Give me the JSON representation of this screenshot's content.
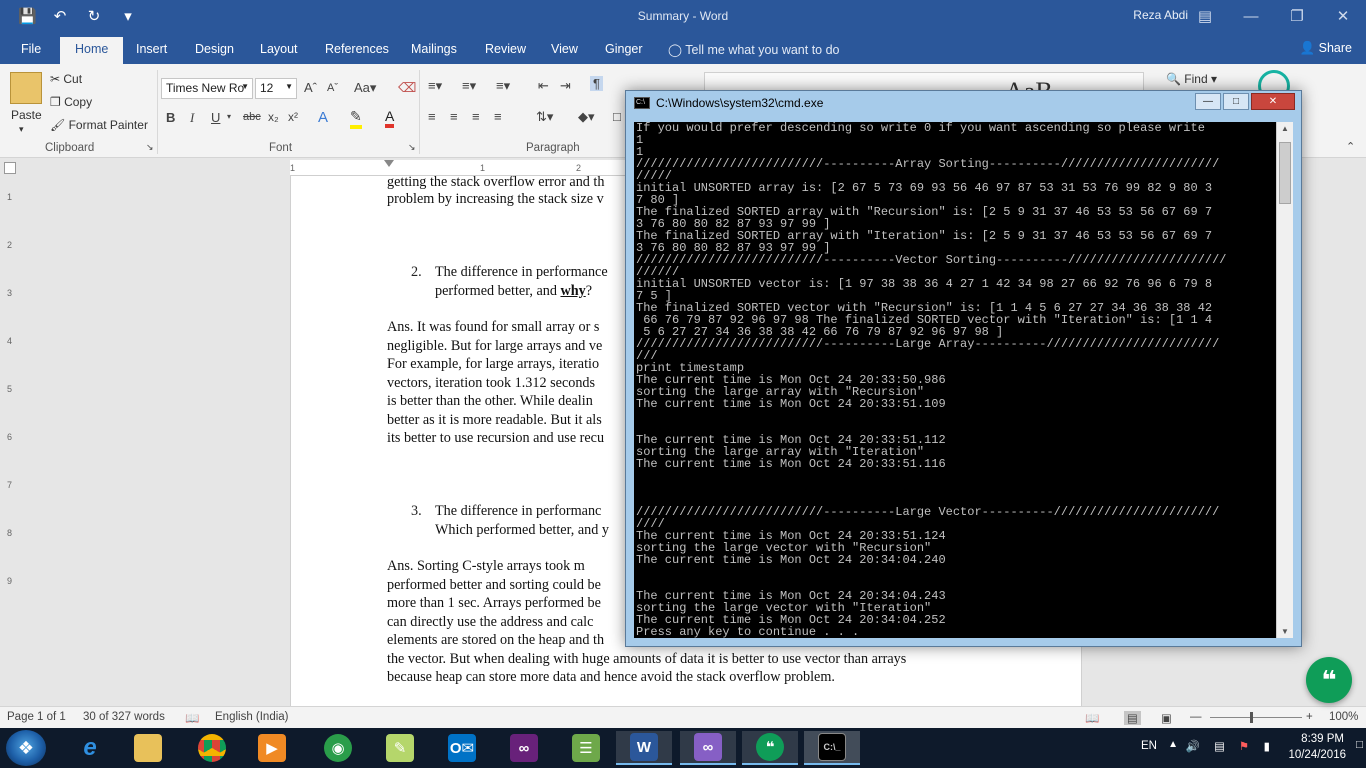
{
  "word": {
    "doc_title": "Summary - Word",
    "user": "Reza Abdi",
    "tabs": [
      "File",
      "Home",
      "Insert",
      "Design",
      "Layout",
      "References",
      "Mailings",
      "Review",
      "View",
      "Ginger"
    ],
    "tell_me": "Tell me what you want to do",
    "share": "Share",
    "clipboard": {
      "paste": "Paste",
      "cut": "Cut",
      "copy": "Copy",
      "format_painter": "Format Painter",
      "label": "Clipboard"
    },
    "font": {
      "name": "Times New Ro",
      "size": "12",
      "label": "Font"
    },
    "paragraph_label": "Paragraph",
    "find": "Find",
    "styles_preview": "AaB",
    "page_lines": [
      "getting the stack overflow error and th",
      "problem by increasing the stack size v"
    ],
    "item2": {
      "num": "2.",
      "line1": "The difference in performance",
      "line2_pre": "performed better, and ",
      "line2_bold": "why",
      "line2_post": "?"
    },
    "ans1": [
      "Ans. It was found for small array or s",
      "negligible. But for large arrays and ve",
      "For example, for large arrays, iteratio",
      "vectors, iteration took 1.312 seconds",
      "is better than the other. While dealin",
      "better as it is more readable. But it als",
      "its better to use recursion and use recu"
    ],
    "item3": {
      "num": "3.",
      "line1": "The difference in performanc",
      "line2": "Which performed better, and y"
    },
    "ans2": [
      "Ans. Sorting C-style arrays took m",
      "performed better and sorting could be",
      "more than 1 sec. Arrays performed be",
      "can directly use the address and calc",
      "elements are stored on the heap and th",
      "the vector. But when dealing with huge amounts of data it is better to use vector than arrays",
      "because heap can store more data and hence avoid the stack overflow problem."
    ],
    "status": {
      "page": "Page 1 of 1",
      "words": "30 of 327 words",
      "language": "English (India)",
      "zoom": "100%"
    }
  },
  "cmd": {
    "title": "C:\\Windows\\system32\\cmd.exe",
    "lines": [
      "If you would prefer descending so write 0 if you want ascending so please write",
      "1",
      "1",
      "//////////////////////////----------Array Sorting----------//////////////////////",
      "/////",
      "initial UNSORTED array is: [2 67 5 73 69 93 56 46 97 87 53 31 53 76 99 82 9 80 3",
      "7 80 ]",
      "The finalized SORTED array with \"Recursion\" is: [2 5 9 31 37 46 53 53 56 67 69 7",
      "3 76 80 80 82 87 93 97 99 ]",
      "The finalized SORTED array with \"Iteration\" is: [2 5 9 31 37 46 53 53 56 67 69 7",
      "3 76 80 80 82 87 93 97 99 ]",
      "//////////////////////////----------Vector Sorting----------//////////////////////",
      "//////",
      "initial UNSORTED vector is: [1 97 38 38 36 4 27 1 42 34 98 27 66 92 76 96 6 79 8",
      "7 5 ]",
      "The finalized SORTED vector with \"Recursion\" is: [1 1 4 5 6 27 27 34 36 38 38 42",
      " 66 76 79 87 92 96 97 98 The finalized SORTED vector with \"Iteration\" is: [1 1 4",
      " 5 6 27 27 34 36 38 38 42 66 76 79 87 92 96 97 98 ]",
      "//////////////////////////----------Large Array----------////////////////////////",
      "///",
      "print timestamp",
      "The current time is Mon Oct 24 20:33:50.986",
      "sorting the large array with \"Recursion\"",
      "The current time is Mon Oct 24 20:33:51.109",
      "",
      "",
      "The current time is Mon Oct 24 20:33:51.112",
      "sorting the large array with \"Iteration\"",
      "The current time is Mon Oct 24 20:33:51.116",
      "",
      "",
      "",
      "//////////////////////////----------Large Vector----------///////////////////////",
      "////",
      "The current time is Mon Oct 24 20:33:51.124",
      "sorting the large vector with \"Recursion\"",
      "The current time is Mon Oct 24 20:34:04.240",
      "",
      "",
      "The current time is Mon Oct 24 20:34:04.243",
      "sorting the large vector with \"Iteration\"",
      "The current time is Mon Oct 24 20:34:04.252",
      "Press any key to continue . . ."
    ]
  },
  "tray": {
    "lang": "EN",
    "time": "8:39 PM",
    "date": "10/24/2016"
  },
  "colors": {
    "word_blue": "#2b579a",
    "console_bg": "#000000",
    "console_fg": "#c0c0c0",
    "hangouts_green": "#0f9d58"
  }
}
